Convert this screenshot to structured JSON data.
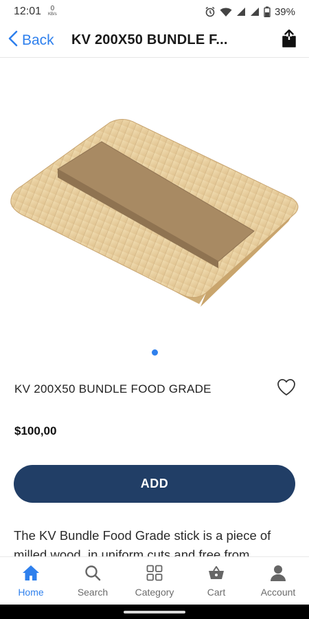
{
  "status_bar": {
    "time": "12:01",
    "net_speed_value": "0",
    "net_speed_unit": "KB/s",
    "battery": "39%"
  },
  "nav": {
    "back_label": "Back",
    "title": "KV 200X50 BUNDLE F..."
  },
  "carousel": {
    "page_count": 1,
    "active_index": 0
  },
  "product": {
    "name": "KV 200X50 BUNDLE FOOD GRADE",
    "price": "$100,00",
    "add_label": "ADD",
    "description": "The KV Bundle Food Grade stick is a piece of milled wood, in uniform cuts and free from"
  },
  "tabs": [
    {
      "label": "Home",
      "icon": "home-icon",
      "active": true
    },
    {
      "label": "Search",
      "icon": "search-icon",
      "active": false
    },
    {
      "label": "Category",
      "icon": "grid-icon",
      "active": false
    },
    {
      "label": "Cart",
      "icon": "basket-icon",
      "active": false
    },
    {
      "label": "Account",
      "icon": "person-icon",
      "active": false
    }
  ],
  "colors": {
    "accent": "#2f80ed",
    "button": "#213e66",
    "stick": "#e6cfa0",
    "band": "#a88a63"
  }
}
